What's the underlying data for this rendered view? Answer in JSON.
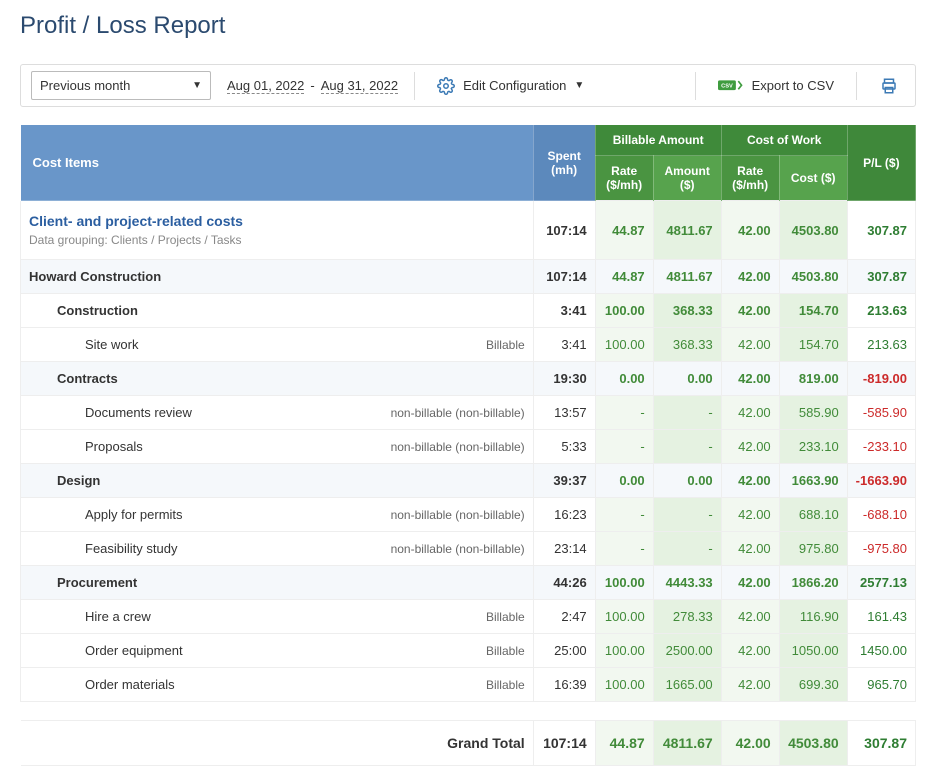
{
  "title": "Profit / Loss Report",
  "toolbar": {
    "period_label": "Previous month",
    "date_from": "Aug 01, 2022",
    "date_to": "Aug 31, 2022",
    "edit_config": "Edit Configuration",
    "export_csv": "Export to CSV"
  },
  "headers": {
    "cost_items": "Cost Items",
    "spent": "Spent (mh)",
    "billable_amount": "Billable Amount",
    "cost_of_work": "Cost of Work",
    "pl": "P/L ($)",
    "rate": "Rate ($/mh)",
    "amount": "Amount ($)",
    "cost": "Cost ($)"
  },
  "section": {
    "name": "Client- and project-related costs",
    "grouping": "Data grouping: Clients / Projects / Tasks",
    "spent": "107:14",
    "bill_rate": "44.87",
    "bill_amount": "4811.67",
    "cost_rate": "42.00",
    "cost": "4503.80",
    "pl": "307.87"
  },
  "rows": [
    {
      "level": 1,
      "name": "Howard Construction",
      "spent": "107:14",
      "bill_rate": "44.87",
      "bill_amount": "4811.67",
      "cost_rate": "42.00",
      "cost": "4503.80",
      "pl": "307.87",
      "shaded": true
    },
    {
      "level": 2,
      "name": "Construction",
      "spent": "3:41",
      "bill_rate": "100.00",
      "bill_amount": "368.33",
      "cost_rate": "42.00",
      "cost": "154.70",
      "pl": "213.63"
    },
    {
      "level": 3,
      "name": "Site work",
      "tag": "Billable",
      "spent": "3:41",
      "bill_rate": "100.00",
      "bill_amount": "368.33",
      "cost_rate": "42.00",
      "cost": "154.70",
      "pl": "213.63"
    },
    {
      "level": 2,
      "name": "Contracts",
      "spent": "19:30",
      "bill_rate": "0.00",
      "bill_amount": "0.00",
      "cost_rate": "42.00",
      "cost": "819.00",
      "pl": "-819.00",
      "shaded": true
    },
    {
      "level": 3,
      "name": "Documents review",
      "tag": "non-billable (non-billable)",
      "spent": "13:57",
      "bill_rate": "-",
      "bill_amount": "-",
      "cost_rate": "42.00",
      "cost": "585.90",
      "pl": "-585.90"
    },
    {
      "level": 3,
      "name": "Proposals",
      "tag": "non-billable (non-billable)",
      "spent": "5:33",
      "bill_rate": "-",
      "bill_amount": "-",
      "cost_rate": "42.00",
      "cost": "233.10",
      "pl": "-233.10"
    },
    {
      "level": 2,
      "name": "Design",
      "spent": "39:37",
      "bill_rate": "0.00",
      "bill_amount": "0.00",
      "cost_rate": "42.00",
      "cost": "1663.90",
      "pl": "-1663.90",
      "shaded": true
    },
    {
      "level": 3,
      "name": "Apply for permits",
      "tag": "non-billable (non-billable)",
      "spent": "16:23",
      "bill_rate": "-",
      "bill_amount": "-",
      "cost_rate": "42.00",
      "cost": "688.10",
      "pl": "-688.10"
    },
    {
      "level": 3,
      "name": "Feasibility study",
      "tag": "non-billable (non-billable)",
      "spent": "23:14",
      "bill_rate": "-",
      "bill_amount": "-",
      "cost_rate": "42.00",
      "cost": "975.80",
      "pl": "-975.80"
    },
    {
      "level": 2,
      "name": "Procurement",
      "spent": "44:26",
      "bill_rate": "100.00",
      "bill_amount": "4443.33",
      "cost_rate": "42.00",
      "cost": "1866.20",
      "pl": "2577.13",
      "shaded": true
    },
    {
      "level": 3,
      "name": "Hire a crew",
      "tag": "Billable",
      "spent": "2:47",
      "bill_rate": "100.00",
      "bill_amount": "278.33",
      "cost_rate": "42.00",
      "cost": "116.90",
      "pl": "161.43"
    },
    {
      "level": 3,
      "name": "Order equipment",
      "tag": "Billable",
      "spent": "25:00",
      "bill_rate": "100.00",
      "bill_amount": "2500.00",
      "cost_rate": "42.00",
      "cost": "1050.00",
      "pl": "1450.00"
    },
    {
      "level": 3,
      "name": "Order materials",
      "tag": "Billable",
      "spent": "16:39",
      "bill_rate": "100.00",
      "bill_amount": "1665.00",
      "cost_rate": "42.00",
      "cost": "699.30",
      "pl": "965.70"
    }
  ],
  "grand": {
    "label": "Grand Total",
    "spent": "107:14",
    "bill_rate": "44.87",
    "bill_amount": "4811.67",
    "cost_rate": "42.00",
    "cost": "4503.80",
    "pl": "307.87"
  }
}
